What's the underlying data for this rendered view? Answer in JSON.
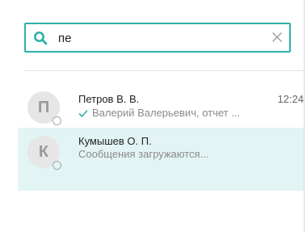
{
  "search": {
    "value": "пе",
    "icon": "search-icon",
    "clear_icon": "close-icon"
  },
  "colors": {
    "accent": "#2eb1ab",
    "selected_row": "#e3f4f4",
    "read_check": "#2eb1ab"
  },
  "chats": [
    {
      "avatar_letter": "П",
      "name": "Петров В. В.",
      "time": "12:24",
      "preview": "Валерий Валерьевич, отчет ...",
      "read_icon": "check-icon"
    },
    {
      "avatar_letter": "К",
      "name": "Кумышев О. П.",
      "time": "",
      "preview": "Сообщения загружаются..."
    }
  ]
}
